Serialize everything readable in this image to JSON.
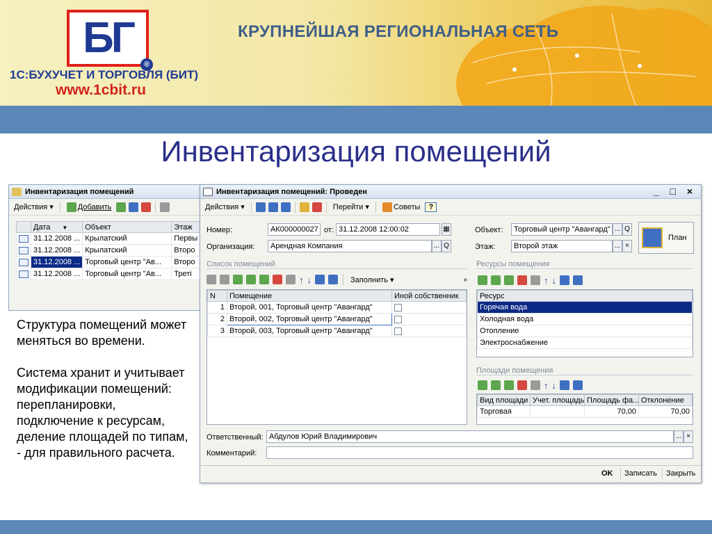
{
  "banner": {
    "logo_letters": "БГ",
    "logo_reg": "®",
    "logo_name": "1С:БУХУЧЕТ И ТОРГОВЛЯ (БИТ)",
    "logo_url": "www.1cbit.ru",
    "tagline": "КРУПНЕЙШАЯ РЕГИОНАЛЬНАЯ СЕТЬ"
  },
  "slide": {
    "title": "Инвентаризация помещений",
    "paragraph1": "Структура помещений может меняться во времени.",
    "paragraph2": "Система хранит и учитывает модификации помещений: перепланировки, подключение к ресурсам, деление площадей по типам, - для правильного расчета."
  },
  "list_window": {
    "title": "Инвентаризация помещений",
    "actions_label": "Действия ▾",
    "add_label": "Добавить",
    "columns": [
      "Дата",
      "Объект",
      "Этаж"
    ],
    "date_sort": "▼",
    "rows": [
      {
        "date": "31.12.2008 ...",
        "object": "Крылатский",
        "floor": "Первы"
      },
      {
        "date": "31.12.2008 ...",
        "object": "Крылатский",
        "floor": "Второ"
      },
      {
        "date": "31.12.2008 ...",
        "object": "Торговый центр \"Ав...",
        "floor": "Второ"
      },
      {
        "date": "31.12.2008 ...",
        "object": "Торговый центр \"Ав...",
        "floor": "Треті"
      }
    ]
  },
  "doc_window": {
    "title": "Инвентаризация помещений: Проведен",
    "controls": "_ □ ×",
    "toolbar": {
      "actions": "Действия ▾",
      "goto": "Перейти ▾",
      "tips": "Советы",
      "help": "?"
    },
    "number_label": "Номер:",
    "number_value": "АК000000027",
    "from_label": "от:",
    "date_value": "31.12.2008 12:00:02",
    "org_label": "Организация:",
    "org_value": "Арендная Компания",
    "object_label": "Объект:",
    "object_value": "Торговый центр \"Авангард\"",
    "floor_label": "Этаж:",
    "floor_value": "Второй этаж",
    "plan_label": "План",
    "rooms_section": "Список помещений",
    "fill_label": "Заполнить ▾",
    "rooms_columns": [
      "N",
      "Помещение",
      "Иной собственник"
    ],
    "rooms": [
      {
        "n": "1",
        "name": "Второй, 001, Торговый центр \"Авангард\""
      },
      {
        "n": "2",
        "name": "Второй, 002, Торговый центр \"Авангард\""
      },
      {
        "n": "3",
        "name": "Второй, 003, Торговый центр \"Авангард\""
      }
    ],
    "resources_section": "Ресурсы помещения",
    "resources_header": "Ресурс",
    "resources": [
      "Горячая вода",
      "Холодная вода",
      "Отопление",
      "Электроснабжение"
    ],
    "areas_section": "Площади помещения",
    "areas_columns": [
      "Вид площади",
      "Учет. площадь",
      "Площадь фа...",
      "Отклонение"
    ],
    "areas": [
      {
        "kind": "Торговая",
        "accounting": "",
        "actual": "70,00",
        "deviation": "70,00"
      }
    ],
    "responsible_label": "Ответственный:",
    "responsible_value": "Абдулов Юрий Владимирович",
    "comment_label": "Комментарий:",
    "comment_value": "",
    "ok_label": "OK",
    "save_label": "Записать",
    "close_label": "Закрыть",
    "ellipsis": "...",
    "clear": "×",
    "search": "Q"
  }
}
